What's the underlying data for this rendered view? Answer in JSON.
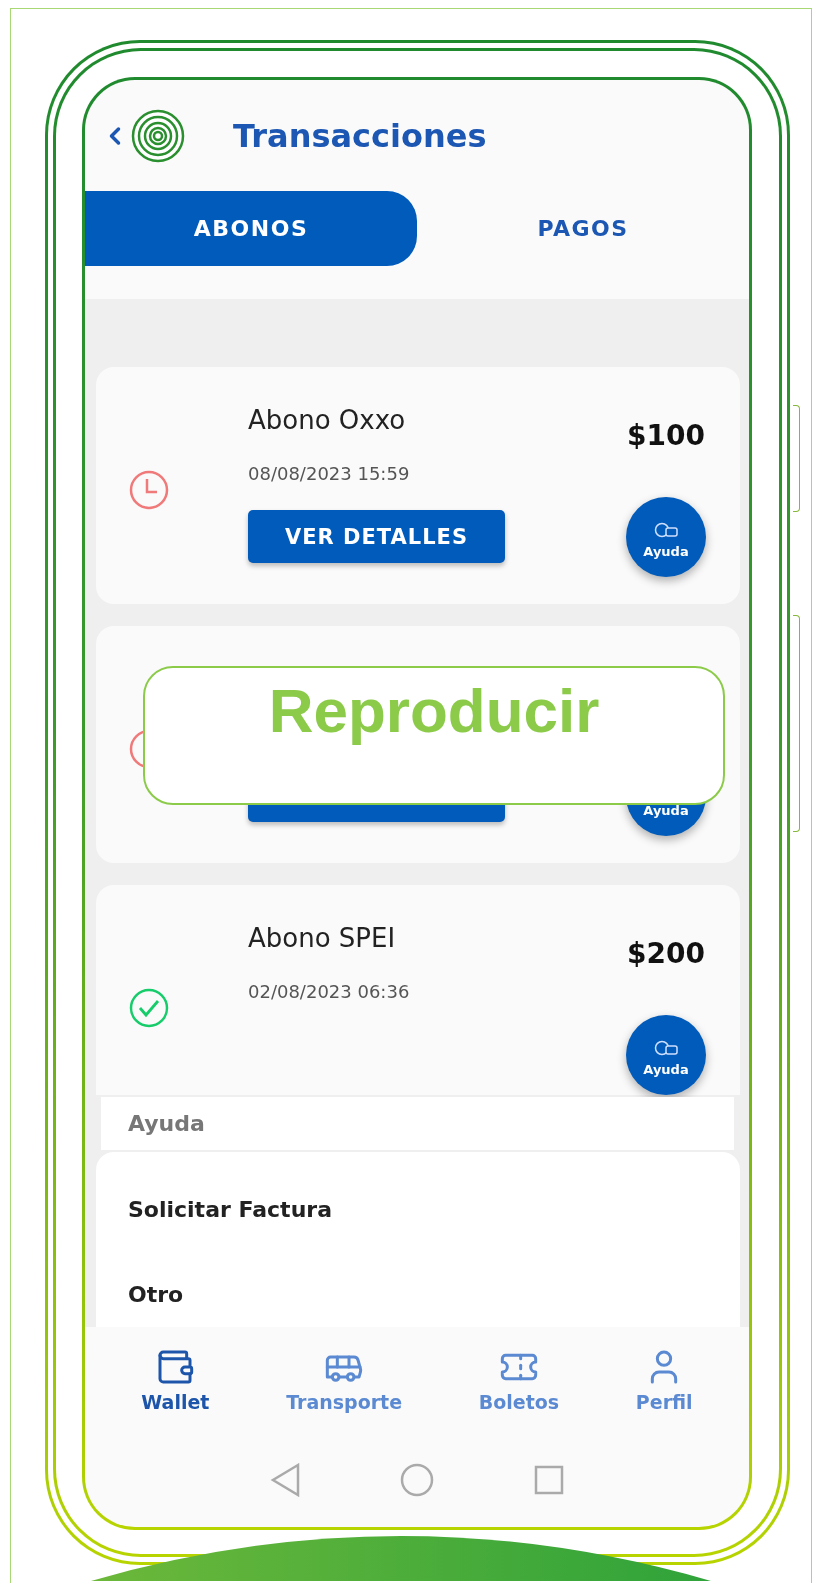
{
  "header": {
    "title": "Transacciones"
  },
  "tabs": [
    {
      "label": "ABONOS",
      "selected": true
    },
    {
      "label": "PAGOS",
      "selected": false
    }
  ],
  "transactions": [
    {
      "title": "Abono Oxxo",
      "date": "08/08/2023 15:59",
      "amount": "$100",
      "kind": "pending",
      "details_button": {
        "shown": true,
        "label": "VER DETALLES"
      },
      "help": "Ayuda",
      "help_icon": true
    },
    {
      "kind": "pending",
      "details_button": {
        "shown": true
      },
      "help": "Ayuda"
    },
    {
      "title": "Abono SPEI",
      "date": "02/08/2023 06:36",
      "amount": "$200",
      "kind": "done",
      "help": "Ayuda",
      "help_icon": true
    }
  ],
  "overlay": {
    "label": "Reproducir"
  },
  "help_sheet": {
    "title": "Ayuda",
    "options": [
      "Solicitar Factura",
      "Otro"
    ]
  },
  "bottom_nav": [
    {
      "label": "Wallet",
      "kind": "wallet",
      "selected": true
    },
    {
      "label": "Transporte",
      "kind": "bus",
      "selected": false
    },
    {
      "label": "Boletos",
      "kind": "ticket",
      "selected": false
    },
    {
      "label": "Perfil",
      "kind": "profile",
      "selected": false
    }
  ]
}
